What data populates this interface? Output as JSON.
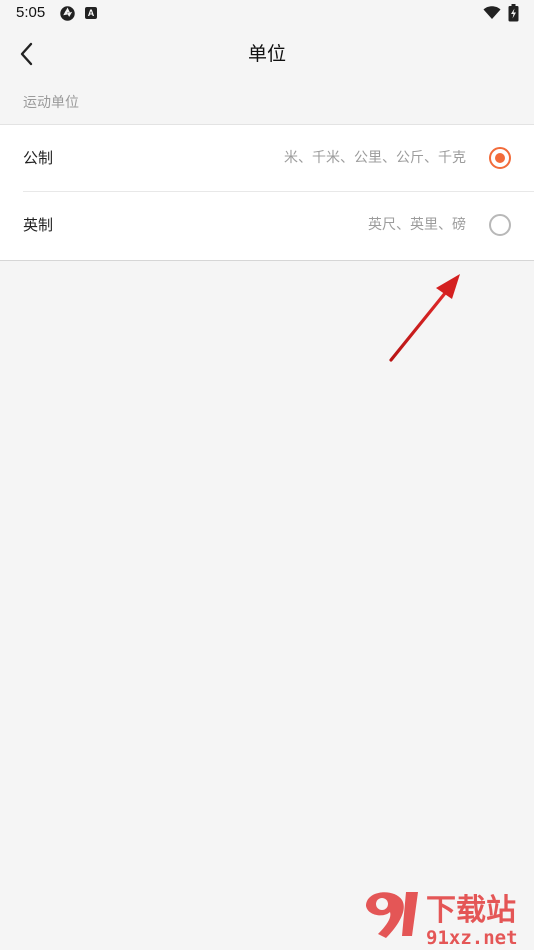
{
  "status_bar": {
    "time": "5:05",
    "icons": [
      "aperture-icon",
      "a-square-icon",
      "wifi-icon",
      "battery-charging-icon"
    ],
    "a_badge": "A"
  },
  "header": {
    "title": "单位",
    "back_icon": "chevron-left-icon"
  },
  "section": {
    "label": "运动单位"
  },
  "options": [
    {
      "name": "公制",
      "description": "米、千米、公里、公斤、千克",
      "selected": true
    },
    {
      "name": "英制",
      "description": "英尺、英里、磅",
      "selected": false
    }
  ],
  "colors": {
    "accent": "#f26b3a",
    "background": "#f5f5f5",
    "card": "#ffffff",
    "annotation_arrow": "#d42020"
  },
  "watermark": {
    "brand_text": "下载站",
    "domain_text": "91xz.net"
  }
}
